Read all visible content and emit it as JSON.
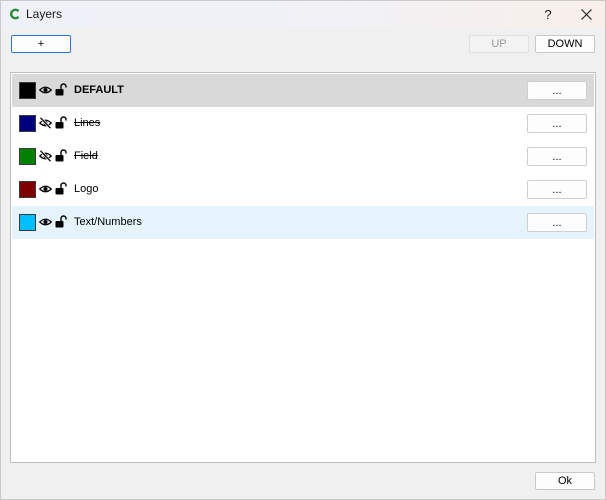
{
  "window": {
    "title": "Layers",
    "help_label": "?",
    "app_icon": "c-logo-icon",
    "close_icon": "close-icon"
  },
  "toolbar": {
    "add_label": "+",
    "up_label": "UP",
    "down_label": "DOWN"
  },
  "layers": [
    {
      "name": "DEFAULT",
      "color": "#000000",
      "visible": true,
      "locked": false,
      "selected": true,
      "options_label": "..."
    },
    {
      "name": "Lines",
      "color": "#00007f",
      "visible": false,
      "locked": false,
      "selected": false,
      "options_label": "..."
    },
    {
      "name": "Field",
      "color": "#007f00",
      "visible": false,
      "locked": false,
      "selected": false,
      "options_label": "..."
    },
    {
      "name": "Logo",
      "color": "#7f0000",
      "visible": true,
      "locked": false,
      "selected": false,
      "options_label": "..."
    },
    {
      "name": "Text/Numbers",
      "color": "#00bfff",
      "visible": true,
      "locked": false,
      "selected": false,
      "options_label": "..."
    }
  ],
  "footer": {
    "ok_label": "Ok"
  }
}
